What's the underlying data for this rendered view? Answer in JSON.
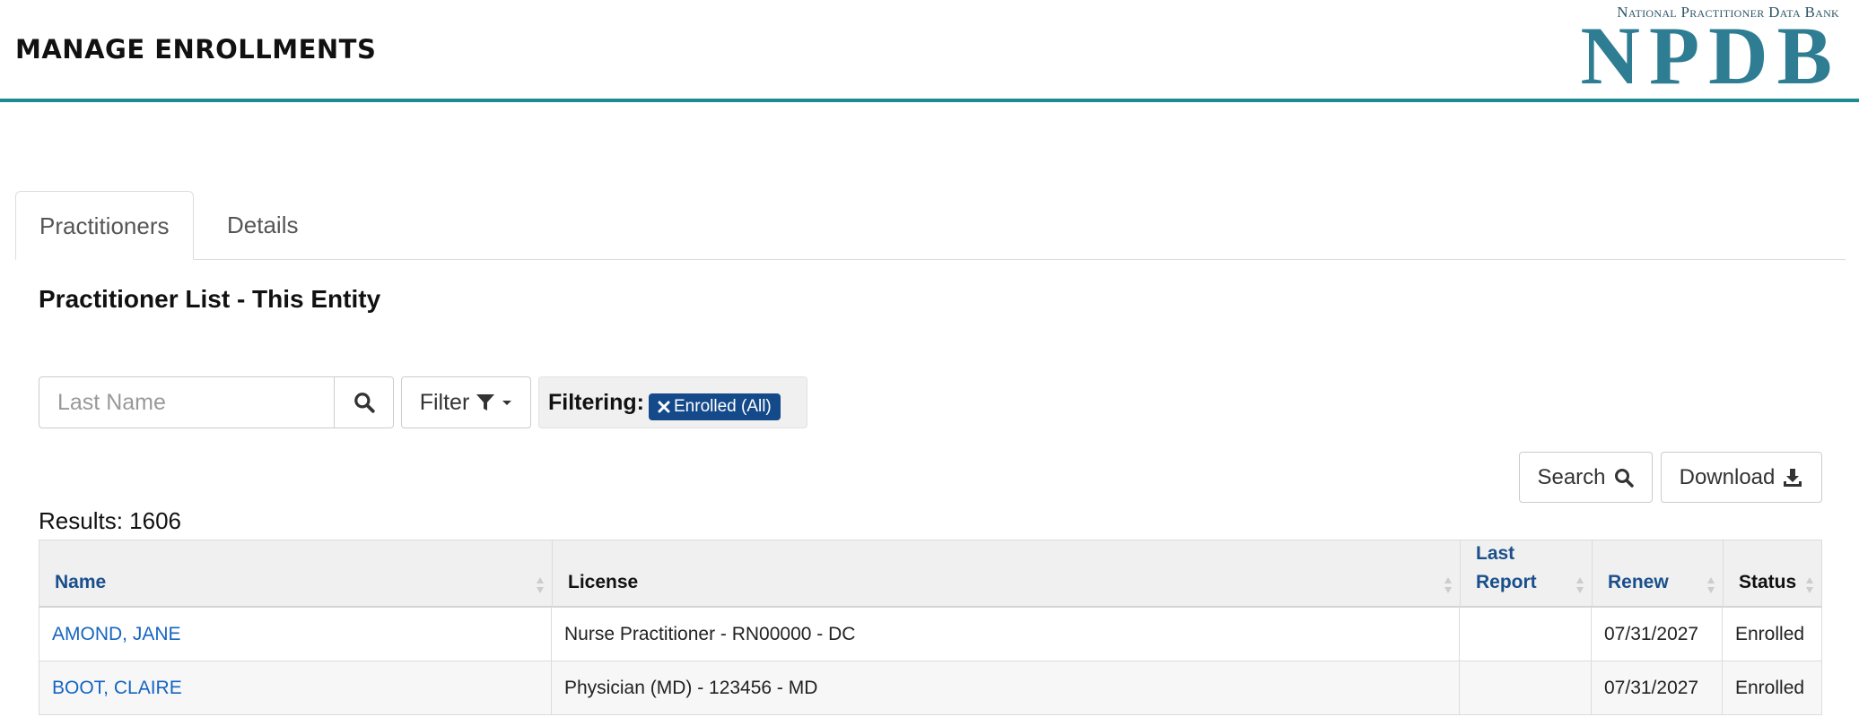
{
  "header": {
    "title": "MANAGE ENROLLMENTS",
    "logo_subtitle": "National Practitioner Data Bank",
    "logo_text": "NPDB",
    "accent_color": "#1b8a93",
    "logo_color": "#2e7d93"
  },
  "tabs": [
    {
      "label": "Practitioners",
      "active": true
    },
    {
      "label": "Details",
      "active": false
    }
  ],
  "section_title": "Practitioner List - This Entity",
  "search": {
    "placeholder": "Last Name",
    "value": "",
    "icon": "search-icon"
  },
  "filter": {
    "label": "Filter",
    "icon": "filter-funnel-icon"
  },
  "filtering": {
    "label": "Filtering:",
    "chips": [
      {
        "label": "Enrolled (All)",
        "color": "#154a8a"
      }
    ]
  },
  "actions": {
    "search_label": "Search",
    "download_label": "Download"
  },
  "results": {
    "label": "Results: 1606"
  },
  "table": {
    "columns": [
      {
        "label": "Name",
        "sortable": true
      },
      {
        "label": "License",
        "sortable": false
      },
      {
        "label": "Last Report",
        "sortable": true
      },
      {
        "label": "Renew",
        "sortable": true
      },
      {
        "label": "Status",
        "sortable": false
      }
    ],
    "rows": [
      {
        "name": "AMOND, JANE",
        "license": "Nurse Practitioner - RN00000 - DC",
        "last_report": "",
        "renew": "07/31/2027",
        "status": "Enrolled"
      },
      {
        "name": "BOOT, CLAIRE",
        "license": "Physician (MD) - 123456 - MD",
        "last_report": "",
        "renew": "07/31/2027",
        "status": "Enrolled"
      }
    ]
  }
}
